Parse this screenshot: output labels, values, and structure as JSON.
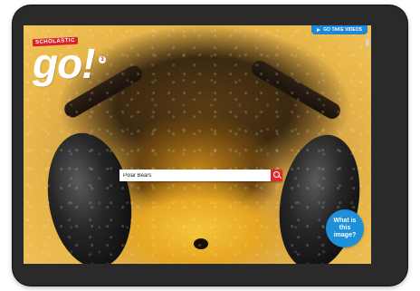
{
  "brand": {
    "publisher": "SCHOLASTIC",
    "logo": "go!",
    "badge": "3",
    "accent_color": "#d8232a"
  },
  "header": {
    "top_link_label": "GO TAKE VIDEOS",
    "top_link_icon": "play-icon",
    "top_link_color": "#1e88d6"
  },
  "search": {
    "value": "Polar Bears",
    "icon": "search-icon",
    "button_color": "#e02a2f"
  },
  "hero": {
    "subject": "bee-closeup-photo"
  },
  "what_is_this": {
    "label": "What is this image?",
    "color": "#1e8fd9"
  }
}
